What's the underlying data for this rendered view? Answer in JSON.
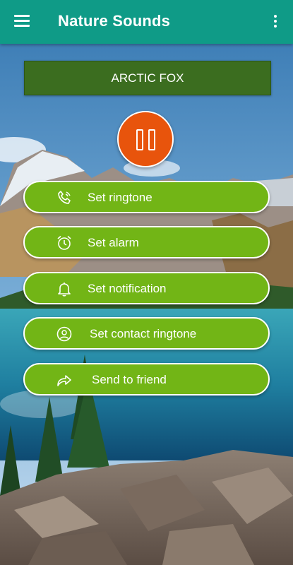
{
  "app": {
    "title": "Nature Sounds",
    "bar_color": "#0f9b87"
  },
  "player": {
    "sound_name": "ARCTIC FOX",
    "state": "playing",
    "control_icon": "pause-icon",
    "control_color": "#e8540c"
  },
  "actions": [
    {
      "label": "Set ringtone",
      "icon": "phone-ringing-icon"
    },
    {
      "label": "Set alarm",
      "icon": "alarm-clock-icon"
    },
    {
      "label": "Set notification",
      "icon": "bell-icon"
    },
    {
      "label": "Set contact ringtone",
      "icon": "contact-icon"
    },
    {
      "label": "Send to friend",
      "icon": "share-arrow-icon"
    }
  ],
  "colors": {
    "banner": "#3b6d1f",
    "action_button": "#72b516"
  }
}
